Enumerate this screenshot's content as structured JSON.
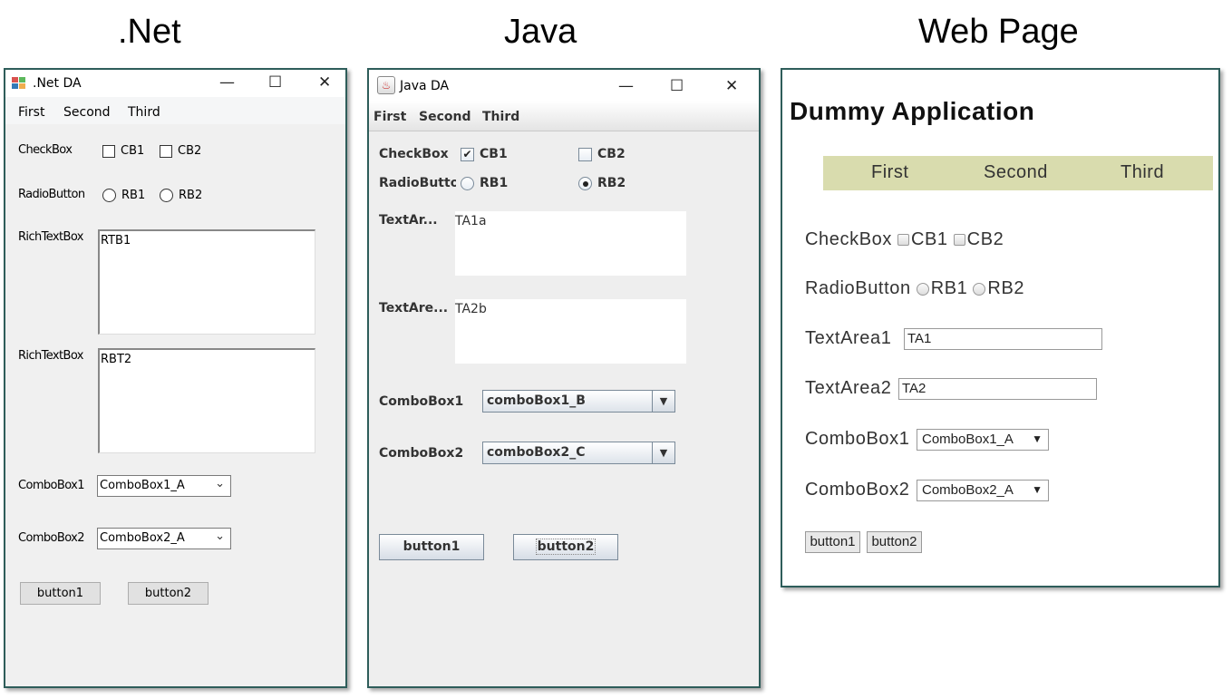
{
  "headings": {
    "net": ".Net",
    "java": "Java",
    "web": "Web Page"
  },
  "net_window": {
    "title": ".Net DA",
    "menu": [
      "First",
      "Second",
      "Third"
    ],
    "checkbox_label": "CheckBox",
    "checkboxes": [
      "CB1",
      "CB2"
    ],
    "radio_label": "RadioButton",
    "radios": [
      "RB1",
      "RB2"
    ],
    "rtb1_label": "RichTextBox",
    "rtb1_value": "RTB1",
    "rtb2_label": "RichTextBox",
    "rtb2_value": "RBT2",
    "combo1_label": "ComboBox1",
    "combo1_value": "ComboBox1_A",
    "combo2_label": "ComboBox2",
    "combo2_value": "ComboBox2_A",
    "buttons": [
      "button1",
      "button2"
    ]
  },
  "java_window": {
    "title": "Java DA",
    "menu": [
      "First",
      "Second",
      "Third"
    ],
    "checkbox_label": "CheckBox",
    "checkboxes": [
      {
        "label": "CB1",
        "checked": true
      },
      {
        "label": "CB2",
        "checked": false
      }
    ],
    "radio_label": "RadioButton",
    "radios": [
      {
        "label": "RB1",
        "selected": false
      },
      {
        "label": "RB2",
        "selected": true
      }
    ],
    "ta1_label": "TextAr...",
    "ta1_value": "TA1a",
    "ta2_label": "TextAre...",
    "ta2_value": "TA2b",
    "combo1_label": "ComboBox1",
    "combo1_value": "comboBox1_B",
    "combo2_label": "ComboBox2",
    "combo2_value": "comboBox2_C",
    "buttons": [
      "button1",
      "button2"
    ]
  },
  "web_window": {
    "app_title": "Dummy Application",
    "nav": [
      "First",
      "Second",
      "Third"
    ],
    "nav_color": "#d9dcae",
    "checkbox_label": "CheckBox",
    "checkboxes": [
      "CB1",
      "CB2"
    ],
    "radio_label": "RadioButton",
    "radios": [
      "RB1",
      "RB2"
    ],
    "ta1_label": "TextArea1",
    "ta1_value": "TA1",
    "ta2_label": "TextArea2",
    "ta2_value": "TA2",
    "combo1_label": "ComboBox1",
    "combo1_value": "ComboBox1_A",
    "combo2_label": "ComboBox2",
    "combo2_value": "ComboBox2_A",
    "buttons": [
      "button1",
      "button2"
    ]
  }
}
